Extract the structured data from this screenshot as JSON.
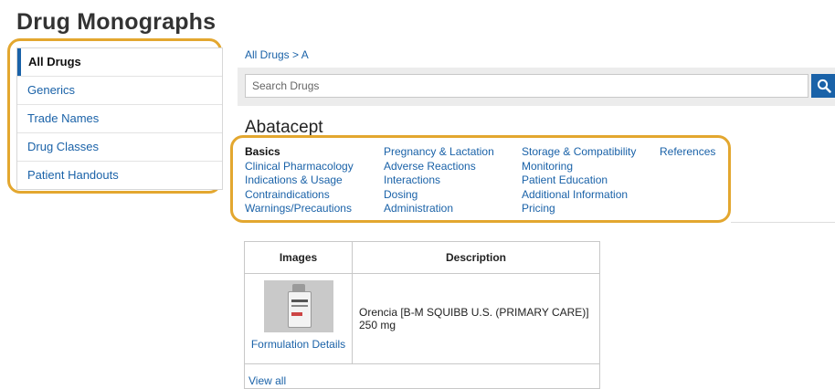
{
  "page": {
    "title": "Drug Monographs"
  },
  "sidebar": {
    "items": [
      {
        "label": "All Drugs",
        "active": true
      },
      {
        "label": "Generics"
      },
      {
        "label": "Trade Names"
      },
      {
        "label": "Drug Classes"
      },
      {
        "label": "Patient Handouts"
      }
    ]
  },
  "breadcrumb": {
    "root": "All Drugs",
    "separator": " > ",
    "current": "A"
  },
  "search": {
    "placeholder": "Search Drugs",
    "value": "",
    "button_icon": "search-icon"
  },
  "drug": {
    "name": "Abatacept"
  },
  "sections": {
    "columns": [
      [
        "Basics",
        "Clinical Pharmacology",
        "Indications & Usage",
        "Contraindications",
        "Warnings/Precautions"
      ],
      [
        "Pregnancy & Lactation",
        "Adverse Reactions",
        "Interactions",
        "Dosing",
        "Administration"
      ],
      [
        "Storage & Compatibility",
        "Monitoring",
        "Patient Education",
        "Additional Information",
        "Pricing"
      ],
      [
        "References"
      ]
    ],
    "current": "Basics"
  },
  "images_table": {
    "headers": [
      "Images",
      "Description"
    ],
    "rows": [
      {
        "thumbnail": "drug-vial-image",
        "link": "Formulation Details",
        "description": "Orencia [B-M SQUIBB U.S. (PRIMARY CARE)] 250 mg"
      }
    ],
    "view_all": "View all"
  },
  "colors": {
    "accent": "#1a62a8",
    "highlight": "#E3A72F",
    "search_bar_bg": "#ececec"
  }
}
